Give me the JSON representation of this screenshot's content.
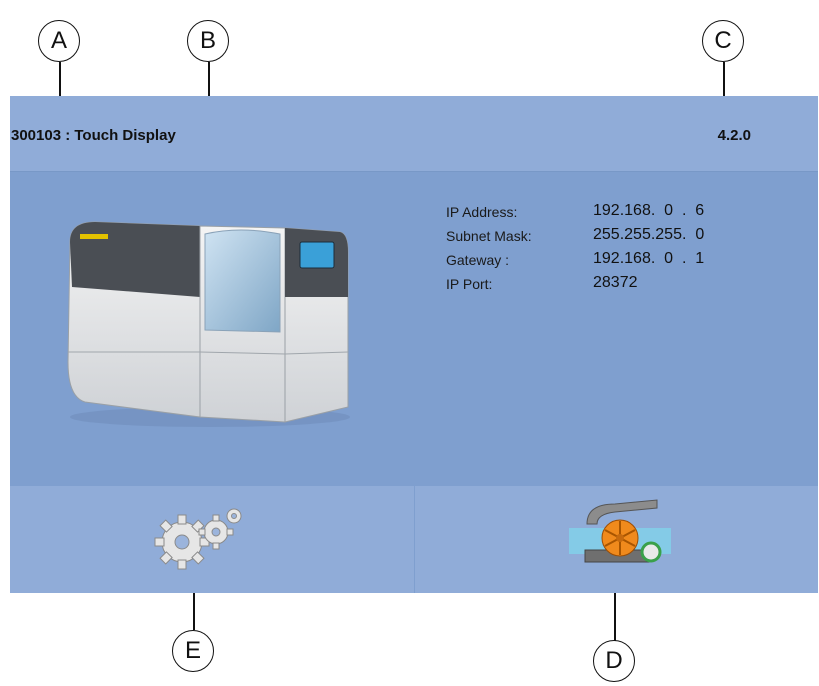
{
  "header": {
    "device_title": "300103 : Touch Display",
    "version": "4.2.0"
  },
  "network": {
    "rows": [
      {
        "label": "IP Address:",
        "value": "192.168.  0  .  6"
      },
      {
        "label": "Subnet Mask:",
        "value": "255.255.255.  0"
      },
      {
        "label": "Gateway :",
        "value": "192.168.  0  .  1"
      },
      {
        "label": "IP Port:",
        "value": "28372"
      }
    ]
  },
  "footer": {
    "left_icon": "gears-icon",
    "right_icon": "fan-maintenance-icon"
  },
  "callouts": [
    "A",
    "B",
    "C",
    "D",
    "E"
  ],
  "colors": {
    "panel_bg": "#7f9fcf",
    "bar_bg": "#90acd8"
  }
}
